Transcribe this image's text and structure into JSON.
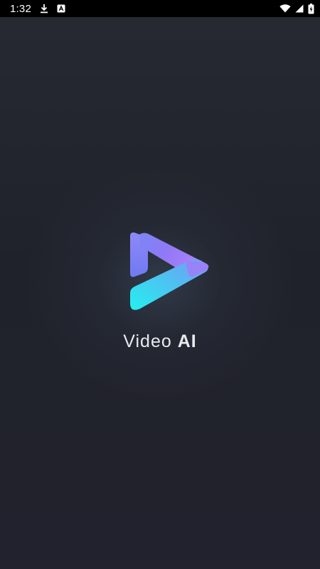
{
  "status_bar": {
    "time": "1:32",
    "icons": [
      "download-icon",
      "app-notification-icon",
      "wifi-icon",
      "cellular-signal-icon",
      "battery-charging-icon"
    ]
  },
  "splash": {
    "app_name_light": "Video",
    "app_name_bold": "AI",
    "logo_icon": "play-logo-icon",
    "colors": {
      "background": "#1f2029",
      "logo_top": "#a37af7",
      "logo_bottom": "#2ee3f0",
      "text": "#e9e9ee"
    }
  }
}
